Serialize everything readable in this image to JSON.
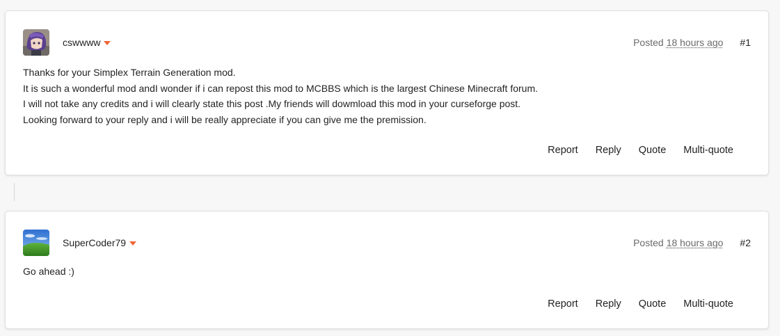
{
  "posts": [
    {
      "username": "cswwww",
      "posted_label": "Posted",
      "timestamp": "18 hours ago",
      "number": "#1",
      "body_lines": [
        "Thanks for your Simplex Terrain Generation mod.",
        "It is such a wonderful mod andI wonder if i can repost this mod to MCBBS which is the largest Chinese Minecraft forum.",
        "I will not take any credits and i will clearly state this post .My friends will dowmload this mod in your curseforge post.",
        "Looking forward to your reply and i will be really appreciate if you can give me the premission."
      ],
      "actions": [
        "Report",
        "Reply",
        "Quote",
        "Multi-quote"
      ]
    },
    {
      "username": "SuperCoder79",
      "posted_label": "Posted",
      "timestamp": "18 hours ago",
      "number": "#2",
      "body_lines": [
        "Go ahead :)"
      ],
      "actions": [
        "Report",
        "Reply",
        "Quote",
        "Multi-quote"
      ]
    }
  ],
  "icons": {
    "user_menu": "caret-down-icon",
    "avatar_1": "anime-character-avatar",
    "avatar_2": "green-hill-sky-avatar"
  },
  "colors": {
    "accent": "#f16436",
    "card": "#ffffff",
    "background": "#f7f7f7",
    "meta_text": "#6a6a6a"
  }
}
